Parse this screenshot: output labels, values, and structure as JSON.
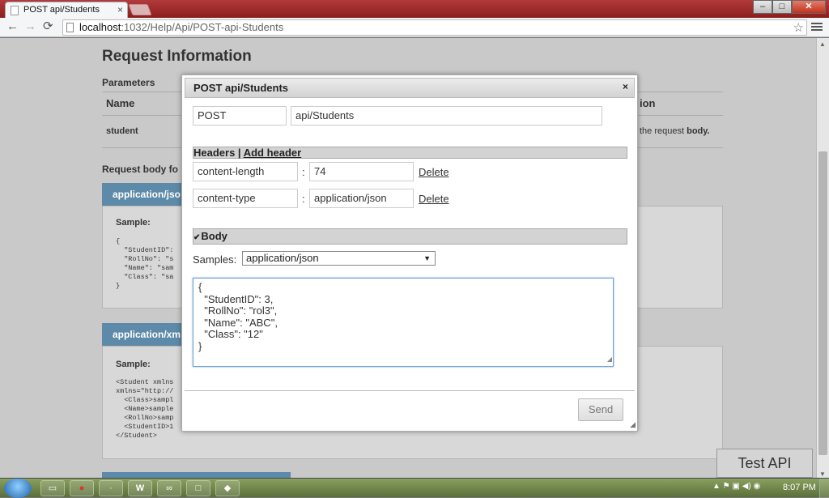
{
  "browser": {
    "tab_title": "POST api/Students",
    "tab_close": "×",
    "url_host": "localhost",
    "url_path": ":1032/Help/Api/POST-api-Students",
    "back": "←",
    "forward": "→",
    "reload": "⟳",
    "star": "☆",
    "window_buttons": [
      "–",
      "□",
      "✕"
    ]
  },
  "page": {
    "heading": "Request Information",
    "parameters_label": "Parameters",
    "table_headers": [
      "Name",
      "ion"
    ],
    "param_name": "student",
    "param_desc_prefix": "the request ",
    "param_desc_bold": "body.",
    "request_body_label": "Request body fo",
    "json_tab": "application/jso",
    "xml_tab": "application/xm",
    "sample_label": "Sample:",
    "json_code": "{\n  \"StudentID\":\n  \"RollNo\": \"s\n  \"Name\": \"sam\n  \"Class\": \"sa\n}",
    "xml_code": "<Student xmlns\nxmlns=\"http://\n  <Class>sampl\n  <Name>sample\n  <RollNo>samp\n  <StudentID>1\n</Student>",
    "test_api_button": "Test API"
  },
  "dialog": {
    "title": "POST api/Students",
    "close": "×",
    "method": "POST",
    "uri": "api/Students",
    "headers_section": "Headers",
    "separator": " | ",
    "add_header": "Add header",
    "headers": [
      {
        "name": "content-length",
        "value": "74",
        "delete": "Delete"
      },
      {
        "name": "content-type",
        "value": "application/json",
        "delete": "Delete"
      }
    ],
    "colon": ":",
    "body_section": "Body",
    "body_checked": "✔",
    "samples_label": "Samples:",
    "samples_selected": "application/json",
    "body": "{\n  \"StudentID\": 3,\n  \"RollNo\": \"rol3\",\n  \"Name\": \"ABC\",\n  \"Class\": \"12\"\n}",
    "send": "Send"
  },
  "taskbar": {
    "clock": "8:07 PM",
    "word_icon": "W",
    "vs_icon": "∞"
  },
  "colors": {
    "accent": "#5d8aa8",
    "titlebar": "#8c1e1e"
  }
}
